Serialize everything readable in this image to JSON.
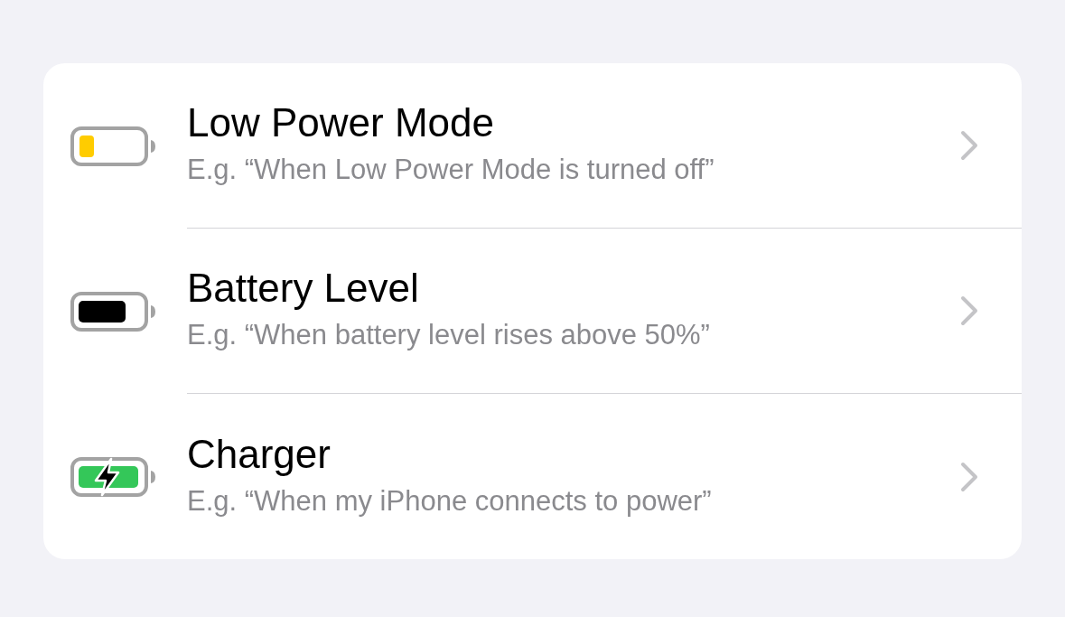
{
  "triggers": [
    {
      "kind": "low-power",
      "title": "Low Power Mode",
      "subtitle": "E.g. “When Low Power Mode is turned off”"
    },
    {
      "kind": "full",
      "title": "Battery Level",
      "subtitle": "E.g. “When battery level rises above 50%”"
    },
    {
      "kind": "charging",
      "title": "Charger",
      "subtitle": "E.g. “When my iPhone connects to power”"
    }
  ]
}
